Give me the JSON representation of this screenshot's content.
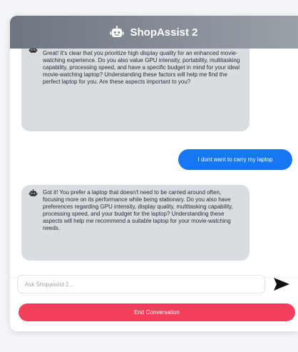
{
  "header": {
    "title": "ShopAssist 2",
    "icon": "robot-icon"
  },
  "messages": [
    {
      "role": "bot",
      "icon": "robot-icon",
      "text": "Great! It's clear that you prioritize high display quality for an enhanced movie-watching experience. Do you also value GPU intensity, portability, multitasking capability, processing speed, and have a specific budget in mind for your ideal movie-watching laptop? Understanding these factors will help me find the perfect laptop for you. Are these aspects important to you?"
    },
    {
      "role": "user",
      "text": "I dont want to carry my laptop"
    },
    {
      "role": "bot",
      "icon": "robot-icon",
      "text": "Got it! You prefer a laptop that doesn't need to be carried around often, focusing more on its performance while being stationary. Do you also have preferences regarding GPU intensity, display quality, multitasking capability, processing speed, and your budget for the laptop? Understanding these aspects will help me recommend a suitable laptop for your movie-watching needs."
    }
  ],
  "input": {
    "placeholder": "Ask Shopassist 2...",
    "value": ""
  },
  "send": {
    "icon": "send-arrow-icon"
  },
  "end_button": {
    "label": "End Conversation"
  },
  "colors": {
    "header_start": "#6d7580",
    "header_end": "#9aa0a8",
    "bot_bubble": "#d9dce1",
    "user_bubble": "#1677f2",
    "end_button": "#f2405c"
  }
}
